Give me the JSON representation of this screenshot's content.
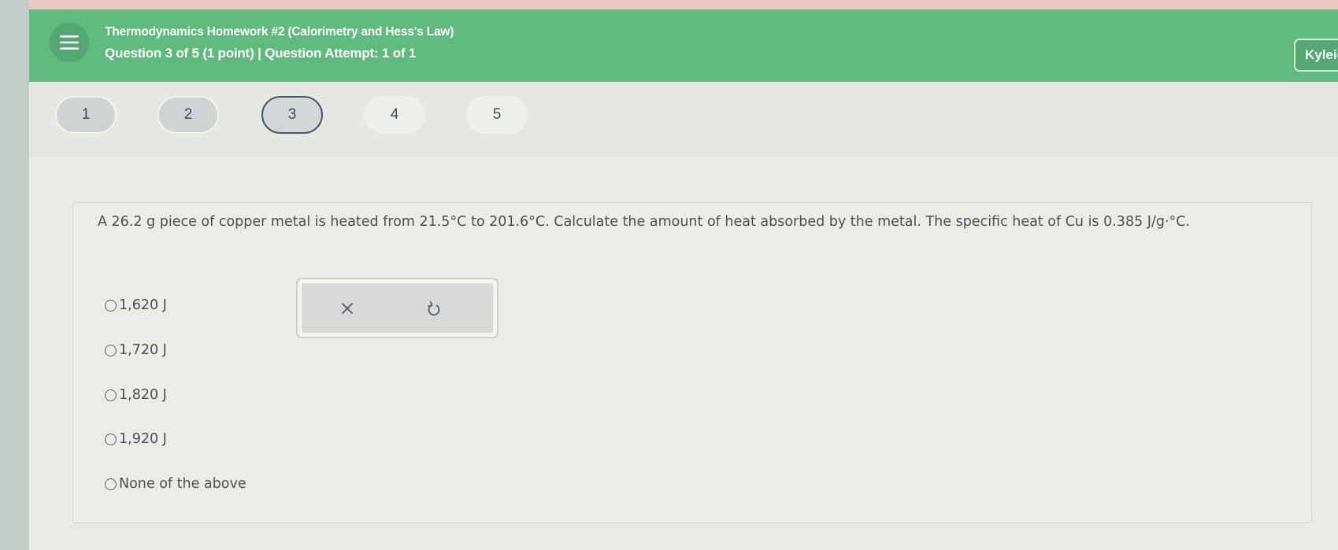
{
  "header": {
    "title": "Thermodynamics Homework #2 (Calorimetry and Hess's Law)",
    "subtitle": "Question 3 of 5 (1 point)  |  Question Attempt: 1 of 1",
    "menu_icon": "hamburger-menu-icon",
    "user_name": "Kyleig",
    "background_color": "#5fba7d"
  },
  "question_nav": {
    "items": [
      {
        "label": "1",
        "state": "answered"
      },
      {
        "label": "2",
        "state": "answered"
      },
      {
        "label": "3",
        "state": "current"
      },
      {
        "label": "4",
        "state": "unanswered"
      },
      {
        "label": "5",
        "state": "unanswered"
      }
    ]
  },
  "question": {
    "text": "A 26.2 g piece of copper metal is heated from 21.5°C to 201.6°C. Calculate the amount of heat absorbed by the metal. The specific heat of Cu is 0.385 J/g·°C.",
    "options": [
      {
        "label": "1,620 J",
        "selected": false
      },
      {
        "label": "1,720 J",
        "selected": false
      },
      {
        "label": "1,820 J",
        "selected": false
      },
      {
        "label": "1,920 J",
        "selected": false
      },
      {
        "label": "None of the above",
        "selected": false
      }
    ]
  },
  "tools": {
    "clear_icon": "x-icon",
    "undo_icon": "undo-icon"
  }
}
